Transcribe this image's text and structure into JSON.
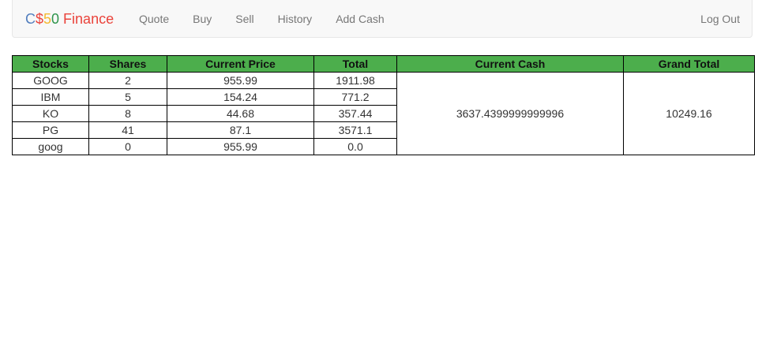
{
  "brand": {
    "parts": [
      {
        "text": "C",
        "color": "#537fbe"
      },
      {
        "text": "$",
        "color": "#ea433b"
      },
      {
        "text": "5",
        "color": "#f5b82e"
      },
      {
        "text": "0",
        "color": "#2e944b"
      },
      {
        "text": " Finance",
        "color": "#ea433b"
      }
    ]
  },
  "nav": {
    "quote": "Quote",
    "buy": "Buy",
    "sell": "Sell",
    "history": "History",
    "add_cash": "Add Cash",
    "log_out": "Log Out"
  },
  "table": {
    "headers": [
      "Stocks",
      "Shares",
      "Current Price",
      "Total",
      "Current Cash",
      "Grand Total"
    ],
    "rows": [
      {
        "symbol": "GOOG",
        "shares": "2",
        "price": "955.99",
        "total": "1911.98"
      },
      {
        "symbol": "IBM",
        "shares": "5",
        "price": "154.24",
        "total": "771.2"
      },
      {
        "symbol": "KO",
        "shares": "8",
        "price": "44.68",
        "total": "357.44"
      },
      {
        "symbol": "PG",
        "shares": "41",
        "price": "87.1",
        "total": "3571.1"
      },
      {
        "symbol": "goog",
        "shares": "0",
        "price": "955.99",
        "total": "0.0"
      }
    ],
    "current_cash": "3637.4399999999996",
    "grand_total": "10249.16",
    "header_color": "#4cae4c"
  }
}
